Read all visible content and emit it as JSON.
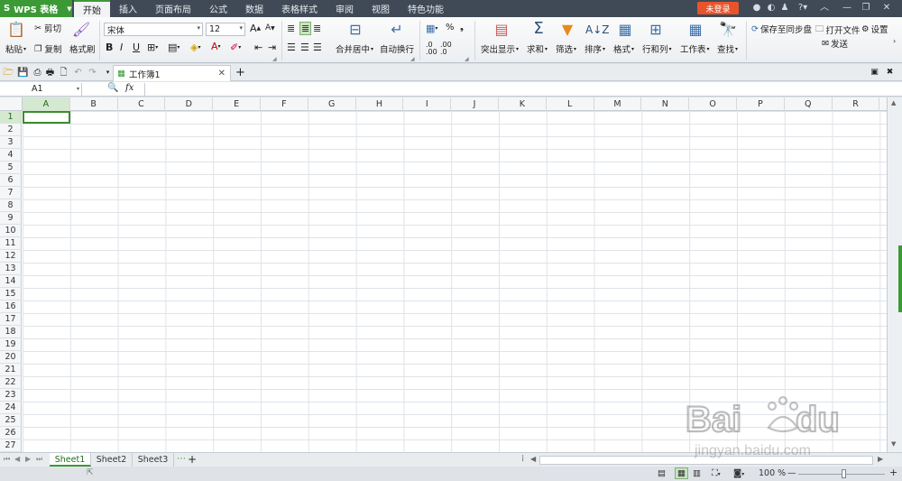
{
  "app": {
    "name": "WPS 表格",
    "logo": "S"
  },
  "menu": {
    "tabs": [
      "开始",
      "插入",
      "页面布局",
      "公式",
      "数据",
      "表格样式",
      "审阅",
      "视图",
      "特色功能"
    ],
    "active": 0
  },
  "login_label": "未登录",
  "ribbon": {
    "paste": "粘贴",
    "cut": "剪切",
    "copy": "复制",
    "format_painter": "格式刷",
    "font_name": "宋体",
    "font_size": "12",
    "bold": "B",
    "italic": "I",
    "underline": "U",
    "merge_center": "合并居中",
    "wrap_text": "自动换行",
    "percent": "%",
    "conditional": "突出显示",
    "sum": "求和",
    "filter": "筛选",
    "sort": "排序",
    "format": "格式",
    "row_col": "行和列",
    "worksheet": "工作表",
    "find": "查找",
    "save_sync": "保存至同步盘",
    "open_file": "打开文件",
    "settings": "设置",
    "send": "发送"
  },
  "doc_tab": {
    "label": "工作簿1"
  },
  "formula_bar": {
    "cell_ref": "A1",
    "fx": "fx",
    "value": ""
  },
  "grid": {
    "columns": [
      "A",
      "B",
      "C",
      "D",
      "E",
      "F",
      "G",
      "H",
      "I",
      "J",
      "K",
      "L",
      "M",
      "N",
      "O",
      "P",
      "Q",
      "R"
    ],
    "rows": [
      "1",
      "2",
      "3",
      "4",
      "5",
      "6",
      "7",
      "8",
      "9",
      "10",
      "11",
      "12",
      "13",
      "14",
      "15",
      "16",
      "17",
      "18",
      "19",
      "20",
      "21",
      "22",
      "23",
      "24",
      "25",
      "26",
      "27"
    ],
    "active_column": "A",
    "active_row": "1"
  },
  "sheets": {
    "tabs": [
      "Sheet1",
      "Sheet2",
      "Sheet3"
    ],
    "active": 0
  },
  "status": {
    "zoom": "100 %",
    "zoom_fraction": 0.52
  },
  "colors": {
    "accent": "#3c9a36",
    "titlebar": "#404a57",
    "login": "#e8542a"
  }
}
